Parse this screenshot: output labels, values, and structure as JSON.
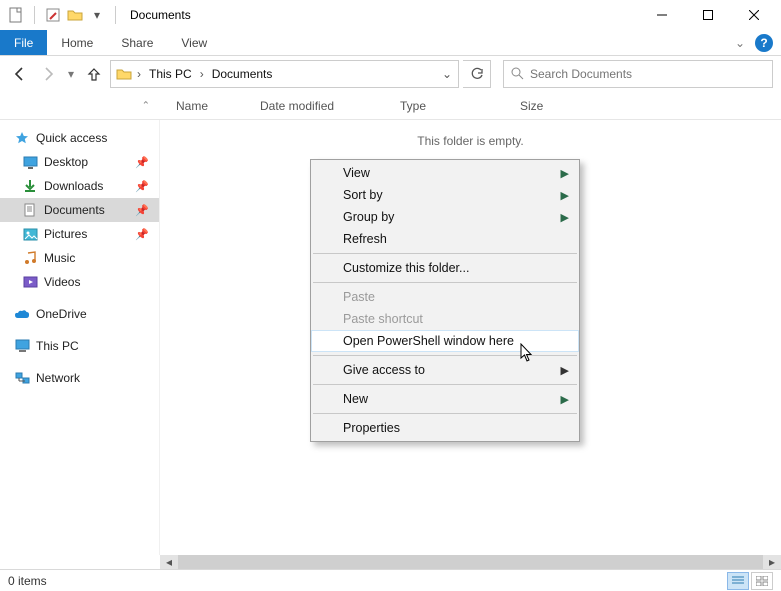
{
  "window": {
    "title": "Documents"
  },
  "ribbon": {
    "file_label": "File",
    "tabs": [
      "Home",
      "Share",
      "View"
    ]
  },
  "breadcrumb": {
    "seg1": "This PC",
    "seg2": "Documents"
  },
  "search": {
    "placeholder": "Search Documents"
  },
  "columns": {
    "name": "Name",
    "date": "Date modified",
    "type": "Type",
    "size": "Size"
  },
  "content": {
    "empty_label": "This folder is empty."
  },
  "sidebar": {
    "quick_access": "Quick access",
    "items": [
      {
        "label": "Desktop"
      },
      {
        "label": "Downloads"
      },
      {
        "label": "Documents"
      },
      {
        "label": "Pictures"
      },
      {
        "label": "Music"
      },
      {
        "label": "Videos"
      }
    ],
    "onedrive": "OneDrive",
    "this_pc": "This PC",
    "network": "Network"
  },
  "context_menu": {
    "view": "View",
    "sort_by": "Sort by",
    "group_by": "Group by",
    "refresh": "Refresh",
    "customize": "Customize this folder...",
    "paste": "Paste",
    "paste_shortcut": "Paste shortcut",
    "powershell": "Open PowerShell window here",
    "give_access": "Give access to",
    "new": "New",
    "properties": "Properties"
  },
  "status": {
    "items": "0 items"
  }
}
